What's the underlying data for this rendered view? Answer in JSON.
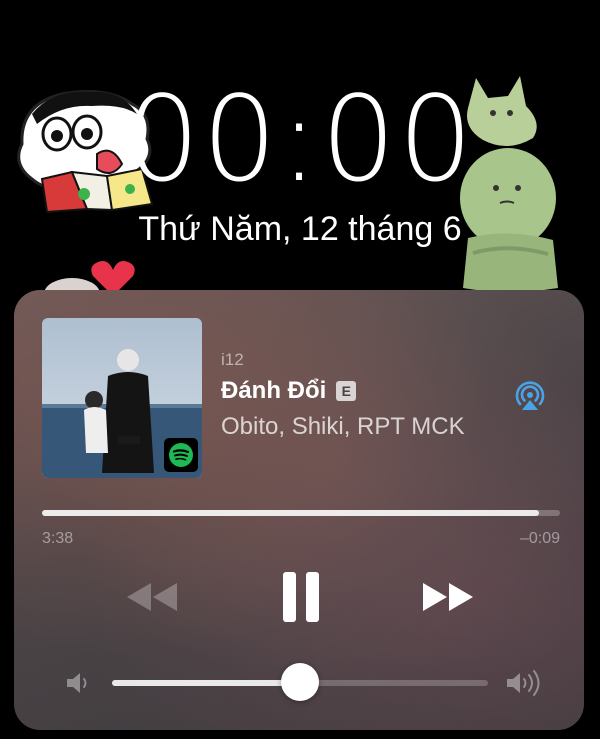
{
  "lockscreen": {
    "time": "00:00",
    "date": "Thứ Năm, 12 tháng 6"
  },
  "now_playing": {
    "source": "i12",
    "title": "Đánh Đổi",
    "explicit_badge": "E",
    "artist": "Obito, Shiki, RPT MCK",
    "elapsed": "3:38",
    "remaining": "–0:09",
    "progress": 0.96,
    "volume": 0.5,
    "app_badge_icon": "spotify-icon",
    "output_icon": "airplay-icon"
  },
  "colors": {
    "accent_airplay": "#4aa3e8",
    "spotify_green": "#1db954",
    "explicit_bg": "#bfbabb"
  },
  "controls": {
    "rewind_icon": "rewind-icon",
    "pause_icon": "pause-icon",
    "forward_icon": "fast-forward-icon",
    "volume_low_icon": "volume-low-icon",
    "volume_high_icon": "volume-high-icon"
  }
}
